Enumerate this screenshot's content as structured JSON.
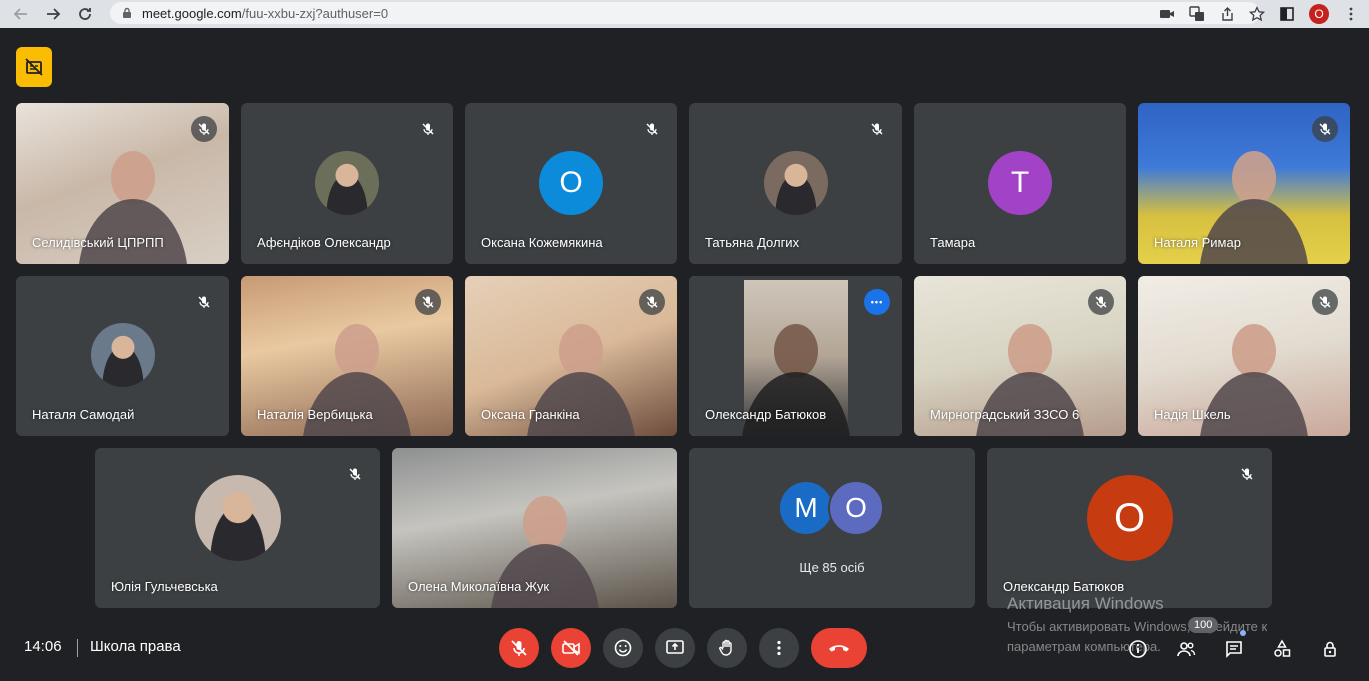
{
  "browser": {
    "url_host": "meet.google.com",
    "url_path": "/fuu-xxbu-zxj?authuser=0",
    "profile_initial": "O"
  },
  "tiles": [
    {
      "name": "Селидівський ЦПРПП",
      "kind": "video",
      "muted": true
    },
    {
      "name": "Афєндіков Олександр",
      "kind": "photo",
      "muted": true
    },
    {
      "name": "Оксана Кожемякина",
      "kind": "letter",
      "letter": "O",
      "color": "#0b8bd9",
      "muted": true
    },
    {
      "name": "Татьяна Долгих",
      "kind": "photo",
      "muted": true
    },
    {
      "name": "Тамара",
      "kind": "letter",
      "letter": "T",
      "color": "#a142c7",
      "muted": false
    },
    {
      "name": "Наталя Римар",
      "kind": "video",
      "muted": true
    },
    {
      "name": "Наталя Самодай",
      "kind": "photo",
      "muted": true
    },
    {
      "name": "Наталія Вербицька",
      "kind": "video",
      "muted": true
    },
    {
      "name": "Оксана Гранкіна",
      "kind": "video",
      "muted": true
    },
    {
      "name": "Олександр Батюков",
      "kind": "video",
      "muted": false,
      "speaking": true
    },
    {
      "name": "Мирноградський ЗЗСО 6",
      "kind": "video",
      "muted": true
    },
    {
      "name": "Надія Шкель",
      "kind": "video",
      "muted": true
    },
    {
      "name": "Юлія Гульчевська",
      "kind": "photo",
      "muted": true
    },
    {
      "name": "Олена Миколаївна Жук",
      "kind": "video",
      "muted": false
    },
    {
      "name": "",
      "kind": "others",
      "muted": false
    },
    {
      "name": "Олександр Батюков",
      "kind": "letter",
      "letter": "O",
      "color": "#c63b0f",
      "muted": true
    }
  ],
  "others": {
    "avatars": [
      {
        "letter": "M",
        "color": "#1a6bc5"
      },
      {
        "letter": "O",
        "color": "#5c6bc0"
      }
    ],
    "label": "Ще 85 осіб"
  },
  "bottom": {
    "time": "14:06",
    "meeting_name": "Школа права",
    "participants_badge": "100"
  },
  "watermark": {
    "title": "Активация Windows",
    "text": "Чтобы активировать Windows, перейдите к параметрам компьютера."
  },
  "colors": {
    "background": "#202124",
    "tile": "#3c4043",
    "danger": "#ea4335",
    "speaking_outline": "#8ab4f8",
    "captions_badge": "#fbbc04"
  }
}
